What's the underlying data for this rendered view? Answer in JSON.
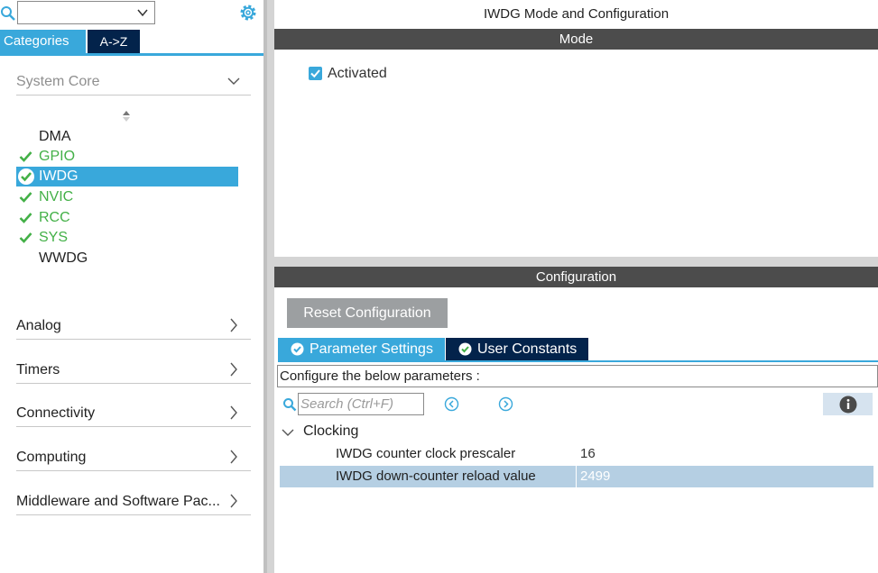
{
  "left": {
    "search_value": "",
    "tabs": {
      "categories": "Categories",
      "az": "A->Z"
    },
    "system_core": {
      "label": "System Core",
      "items": [
        {
          "label": "DMA",
          "status": "none"
        },
        {
          "label": "GPIO",
          "status": "ok"
        },
        {
          "label": "IWDG",
          "status": "ok",
          "selected": true
        },
        {
          "label": "NVIC",
          "status": "ok"
        },
        {
          "label": "RCC",
          "status": "ok"
        },
        {
          "label": "SYS",
          "status": "ok"
        },
        {
          "label": "WWDG",
          "status": "none"
        }
      ]
    },
    "categories": [
      {
        "label": "Analog"
      },
      {
        "label": "Timers"
      },
      {
        "label": "Connectivity"
      },
      {
        "label": "Computing"
      },
      {
        "label": "Middleware and Software Pac..."
      }
    ]
  },
  "right": {
    "title": "IWDG Mode and Configuration",
    "mode": {
      "header": "Mode",
      "activated_label": "Activated",
      "activated": true
    },
    "configuration": {
      "header": "Configuration",
      "reset_label": "Reset Configuration",
      "tabs": {
        "parameters": "Parameter Settings",
        "user_constants": "User Constants"
      },
      "description": "Configure the below parameters :",
      "search_placeholder": "Search (Ctrl+F)",
      "group": "Clocking",
      "params": [
        {
          "name": "IWDG counter clock prescaler",
          "value": "16"
        },
        {
          "name": "IWDG down-counter reload value",
          "value": "2499",
          "selected": true
        }
      ]
    }
  },
  "colors": {
    "accent": "#39a8db",
    "navy": "#03234b",
    "ok_green": "#43b047",
    "header_gray": "#4c4c4c",
    "selected_row": "#b5cfe3"
  }
}
